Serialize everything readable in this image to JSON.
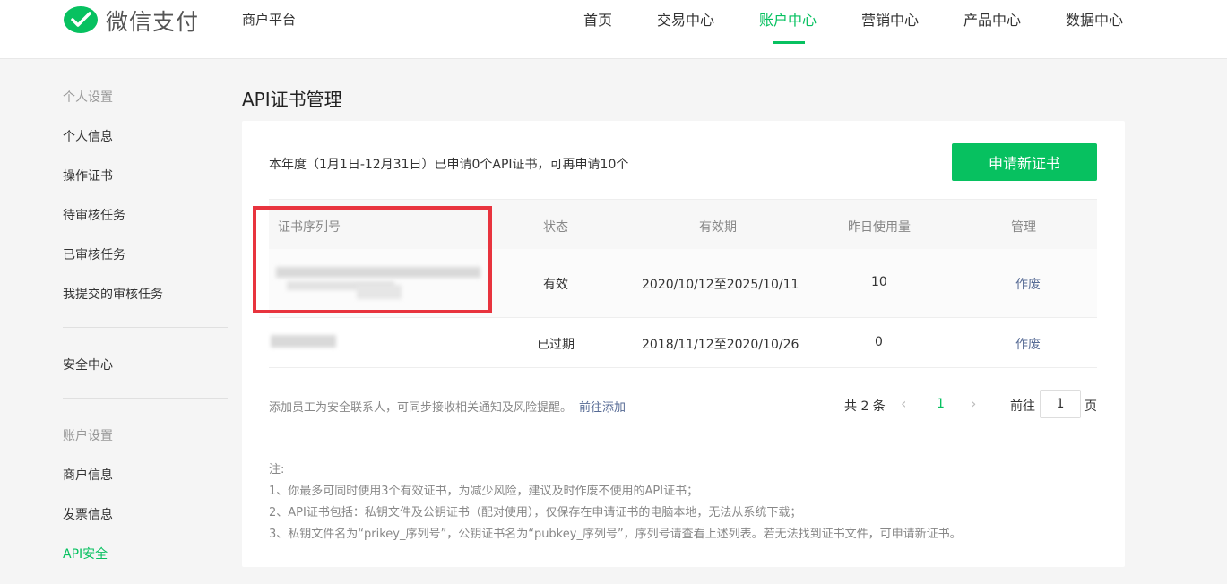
{
  "header": {
    "logo_text": "微信支付",
    "platform": "商户平台",
    "nav": [
      {
        "label": "首页",
        "active": false
      },
      {
        "label": "交易中心",
        "active": false
      },
      {
        "label": "账户中心",
        "active": true
      },
      {
        "label": "营销中心",
        "active": false
      },
      {
        "label": "产品中心",
        "active": false
      },
      {
        "label": "数据中心",
        "active": false
      }
    ]
  },
  "sidebar": {
    "group1_title": "个人设置",
    "group1_items": [
      "个人信息",
      "操作证书",
      "待审核任务",
      "已审核任务",
      "我提交的审核任务"
    ],
    "group2_items": [
      "安全中心"
    ],
    "group3_title": "账户设置",
    "group3_items": [
      "商户信息",
      "发票信息",
      "API安全"
    ],
    "active_item": "API安全"
  },
  "main": {
    "title": "API证书管理",
    "quota_text": "本年度（1月1日-12月31日）已申请0个API证书，可再申请10个",
    "apply_button": "申请新证书",
    "table": {
      "headers": [
        "证书序列号",
        "状态",
        "有效期",
        "昨日使用量",
        "管理"
      ],
      "rows": [
        {
          "serial": "",
          "status": "有效",
          "validity": "2020/10/12至2025/10/11",
          "usage": "10",
          "action": "作废"
        },
        {
          "serial": "",
          "status": "已过期",
          "validity": "2018/11/12至2020/10/26",
          "usage": "0",
          "action": "作废"
        }
      ]
    },
    "tip_text": "添加员工为安全联系人，可同步接收相关通知及风险提醒。",
    "tip_link": "前往添加",
    "pager": {
      "total": "共 2 条",
      "prev": "‹",
      "next": "›",
      "current": "1",
      "goto_label": "前往",
      "goto_value": "1",
      "unit": "页"
    },
    "notes": [
      "注:",
      "1、你最多可同时使用3个有效证书，为减少风险，建议及时作废不使用的API证书；",
      "2、API证书包括：私钥文件及公钥证书（配对使用），仅保存在申请证书的电脑本地，无法从系统下载；",
      "3、私钥文件名为“prikey_序列号”，公钥证书名为“pubkey_序列号”，序列号请查看上述列表。若无法找到证书文件，可申请新证书。"
    ]
  },
  "colors": {
    "accent": "#07c160",
    "link": "#576b95",
    "highlight": "#e8343e"
  }
}
